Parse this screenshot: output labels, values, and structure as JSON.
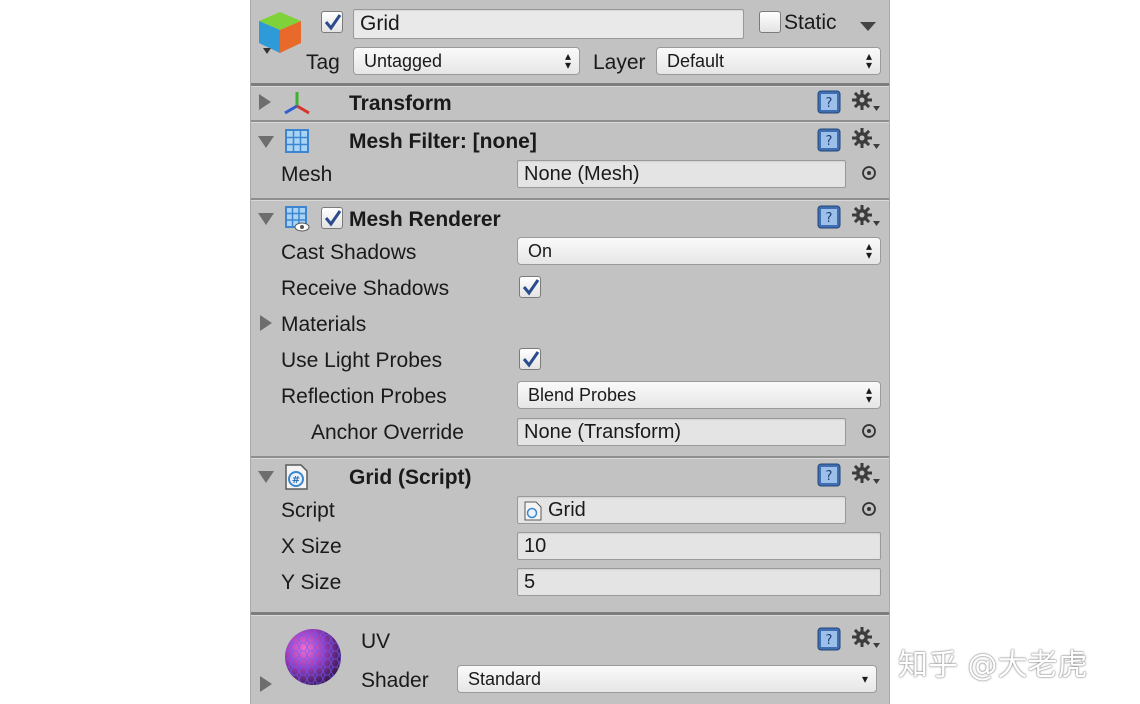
{
  "header": {
    "object_name": "Grid",
    "active_checked": true,
    "static_label": "Static",
    "static_checked": false,
    "tag_label": "Tag",
    "tag_value": "Untagged",
    "layer_label": "Layer",
    "layer_value": "Default"
  },
  "components": {
    "transform": {
      "title": "Transform",
      "expanded": false
    },
    "mesh_filter": {
      "title": "Mesh Filter: [none]",
      "expanded": true,
      "mesh_label": "Mesh",
      "mesh_value": "None (Mesh)"
    },
    "mesh_renderer": {
      "title": "Mesh Renderer",
      "enabled": true,
      "expanded": true,
      "cast_shadows_label": "Cast Shadows",
      "cast_shadows_value": "On",
      "receive_shadows_label": "Receive Shadows",
      "receive_shadows_checked": true,
      "materials_label": "Materials",
      "use_light_probes_label": "Use Light Probes",
      "use_light_probes_checked": true,
      "reflection_probes_label": "Reflection Probes",
      "reflection_probes_value": "Blend Probes",
      "anchor_override_label": "Anchor Override",
      "anchor_override_value": "None (Transform)"
    },
    "grid_script": {
      "title": "Grid (Script)",
      "expanded": true,
      "script_label": "Script",
      "script_value": "Grid",
      "x_size_label": "X Size",
      "x_size_value": "10",
      "y_size_label": "Y Size",
      "y_size_value": "5"
    }
  },
  "material": {
    "name": "UV",
    "shader_label": "Shader",
    "shader_value": "Standard"
  },
  "watermark": "知乎 @大老虎",
  "colors": {
    "panel_bg": "#c2c2c2",
    "checkbox_mark": "#2b4c8c",
    "help_icon_blue": "#3f6fb0"
  }
}
